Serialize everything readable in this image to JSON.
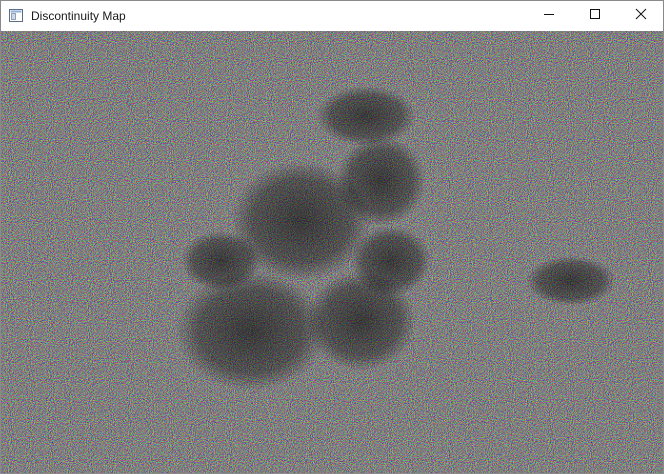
{
  "window": {
    "title": "Discontinuity Map",
    "app_icon": "window-app-icon",
    "controls": {
      "minimize_icon": "minimize-icon",
      "maximize_icon": "maximize-icon",
      "close_icon": "close-icon"
    }
  },
  "canvas": {
    "content": "discontinuity-noise-map",
    "colors": [
      "#ff4a4a",
      "#3ddc55",
      "#4a6bff",
      "#e04ce0",
      "#40d8d8",
      "#d8d040",
      "#f0f0f0",
      "#202020"
    ]
  }
}
